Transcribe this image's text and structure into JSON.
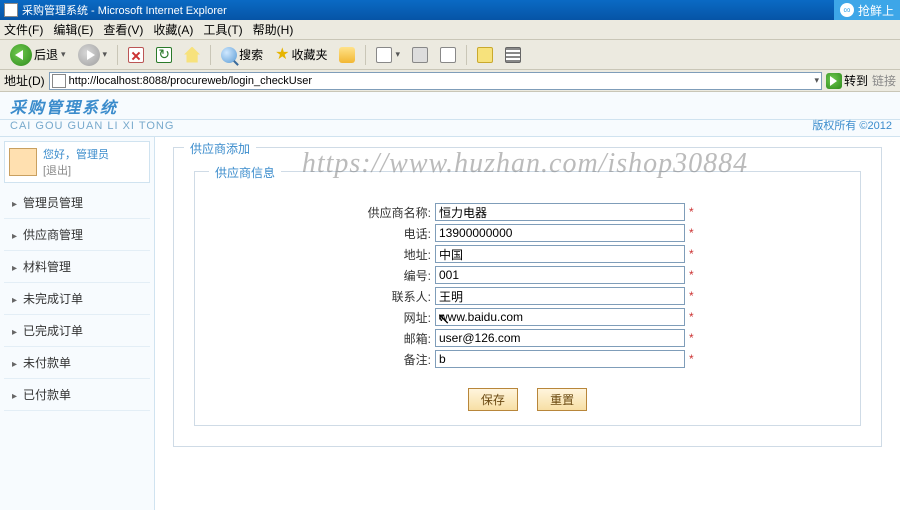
{
  "window": {
    "title": "采购管理系统 - Microsoft Internet Explorer",
    "corner_label": "抢鲜上"
  },
  "menubar": {
    "file": "文件(F)",
    "edit": "编辑(E)",
    "view": "查看(V)",
    "favorites": "收藏(A)",
    "tools": "工具(T)",
    "help": "帮助(H)"
  },
  "toolbar": {
    "back": "后退",
    "search": "搜索",
    "favorites": "收藏夹"
  },
  "addressbar": {
    "label": "地址(D)",
    "url": "http://localhost:8088/procureweb/login_checkUser",
    "go": "转到",
    "links": "链接"
  },
  "app": {
    "title": "采购管理系统",
    "pinyin": "CAI GOU GUAN LI XI TONG",
    "copyright": "版权所有  ©2012"
  },
  "user": {
    "greeting": "您好，管理员",
    "logout": "[退出]"
  },
  "sidebar": {
    "items": [
      {
        "label": "管理员管理"
      },
      {
        "label": "供应商管理"
      },
      {
        "label": "材料管理"
      },
      {
        "label": "未完成订单"
      },
      {
        "label": "已完成订单"
      },
      {
        "label": "未付款单"
      },
      {
        "label": "已付款单"
      }
    ]
  },
  "panel": {
    "title": "供应商添加",
    "fieldset_title": "供应商信息"
  },
  "form": {
    "fields": {
      "name": {
        "label": "供应商名称:",
        "value": "恒力电器"
      },
      "phone": {
        "label": "电话:",
        "value": "13900000000"
      },
      "address": {
        "label": "地址:",
        "value": "中国"
      },
      "code": {
        "label": "编号:",
        "value": "001"
      },
      "contact": {
        "label": "联系人:",
        "value": "王明"
      },
      "website": {
        "label": "网址:",
        "value": "www.baidu.com"
      },
      "email": {
        "label": "邮箱:",
        "value": "user@126.com"
      },
      "remark": {
        "label": "备注:",
        "value": "b"
      }
    },
    "required_mark": "*",
    "buttons": {
      "save": "保存",
      "reset": "重置"
    }
  },
  "watermark": "https://www.huzhan.com/ishop30884"
}
